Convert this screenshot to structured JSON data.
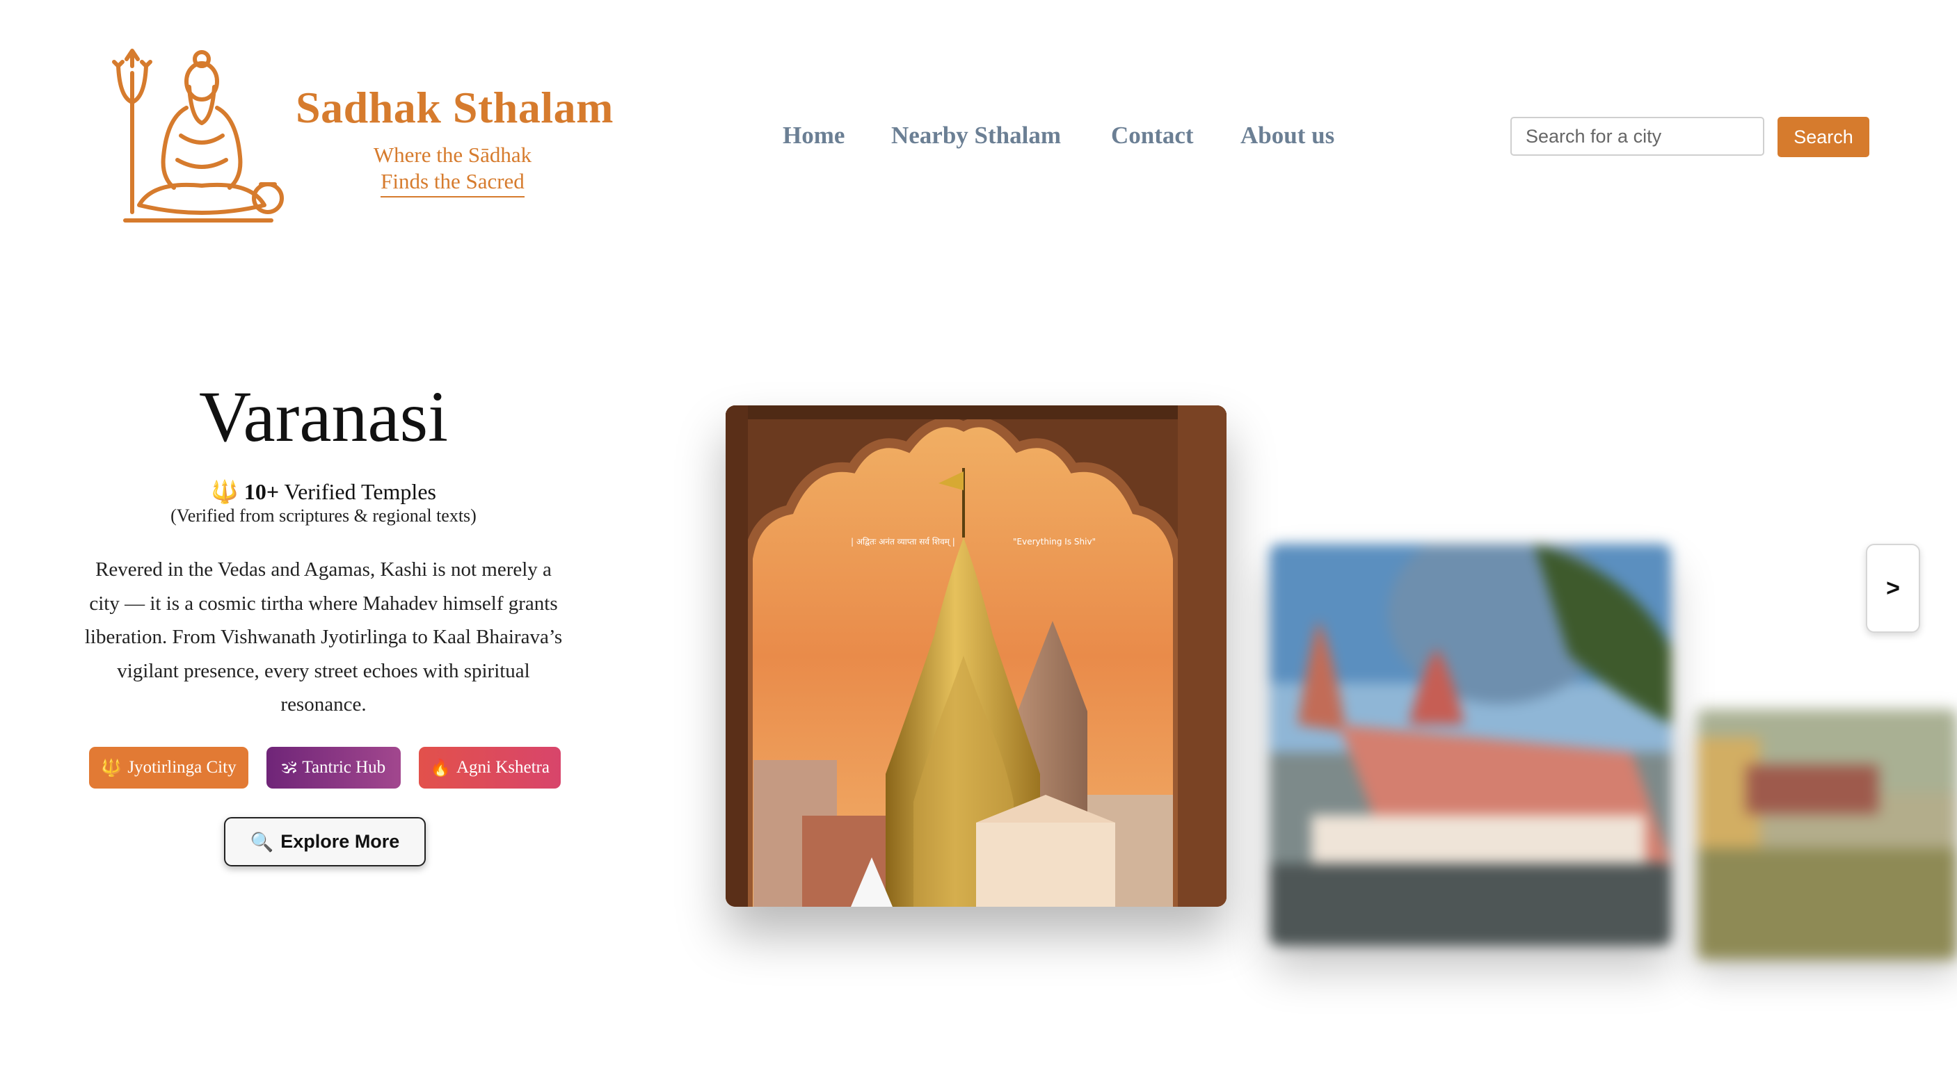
{
  "brand": {
    "title": "Sadhak Sthalam",
    "tagline_line1": "Where the Sādhak",
    "tagline_line2": "Finds the Sacred",
    "logo_icon": "meditating-sadhu-with-trishul-logo",
    "accent_color": "#d67b2d"
  },
  "nav": {
    "items": [
      {
        "label": "Home"
      },
      {
        "label": "Nearby Sthalam"
      },
      {
        "label": "Contact"
      },
      {
        "label": "About us"
      }
    ],
    "color": "#6b7f94"
  },
  "search": {
    "placeholder": "Search for a city",
    "value": "",
    "button_label": "Search"
  },
  "hero": {
    "city": "Varanasi",
    "temple_icon": "trishul-icon",
    "temple_count": "10+",
    "temple_count_suffix": " Verified Temples",
    "verified_note": "(Verified from scriptures & regional texts)",
    "description": "Revered in the Vedas and Agamas, Kashi is not merely a city — it is a cosmic tirtha where Mahadev himself grants liberation. From Vishwanath Jyotirlinga to Kaal Bhairava’s vigilant presence, every street echoes with spiritual resonance.",
    "tags": [
      {
        "icon": "🔱",
        "label": "Jyotirlinga City",
        "color": "#e27a34"
      },
      {
        "icon": "🕉",
        "label": "Tantric Hub",
        "color": "#8b3584"
      },
      {
        "icon": "🔥",
        "label": "Agni Kshetra",
        "color": "#de4b5a"
      }
    ],
    "explore": {
      "icon": "🔍",
      "label": "Explore More"
    }
  },
  "carousel": {
    "main_caption_left": "| अद्वितः अनंत व्याप्ता सर्व शिवम् |",
    "main_caption_right": "\"Everything Is Shiv\"",
    "next_label": ">",
    "cards": [
      {
        "name": "vishwanath-temple-arch-image"
      },
      {
        "name": "kamakhya-temple-image-blurred"
      },
      {
        "name": "palace-temple-image-blurred"
      }
    ]
  }
}
